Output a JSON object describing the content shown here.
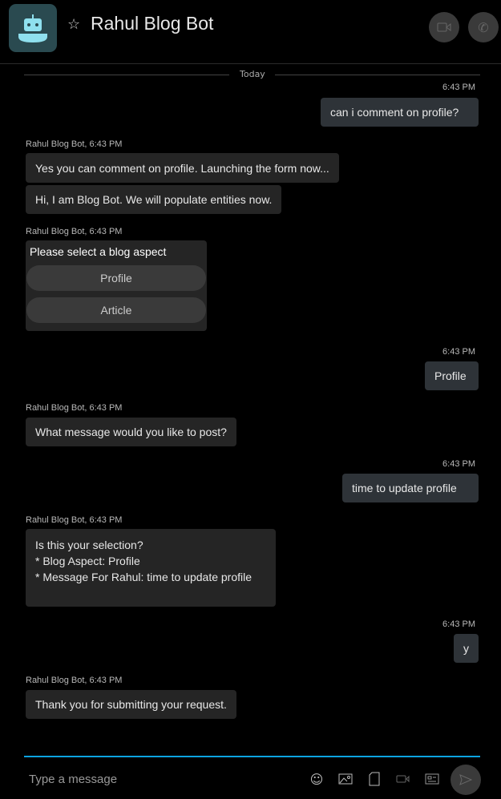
{
  "header": {
    "title": "Rahul Blog Bot",
    "video_icon": "video-call-icon",
    "call_icon": "phone-icon"
  },
  "divider": {
    "label": "Today"
  },
  "messages": [
    {
      "from": "user",
      "time": "6:43 PM",
      "text": "can i comment on profile?"
    },
    {
      "from": "bot",
      "label": "Rahul Blog Bot, 6:43 PM",
      "texts": [
        "Yes you can comment on profile. Launching the form now...",
        "Hi, I am Blog Bot. We will populate entities now."
      ]
    },
    {
      "from": "bot",
      "label": "Rahul Blog Bot, 6:43 PM",
      "card": {
        "title": "Please select a blog aspect",
        "options": [
          "Profile",
          "Article"
        ]
      }
    },
    {
      "from": "user",
      "time": "6:43 PM",
      "text": "Profile"
    },
    {
      "from": "bot",
      "label": "Rahul Blog Bot, 6:43 PM",
      "text": "What message would you like to post?"
    },
    {
      "from": "user",
      "time": "6:43 PM",
      "text": "time to update profile"
    },
    {
      "from": "bot",
      "label": "Rahul Blog Bot, 6:43 PM",
      "text": "Is this your selection?\n* Blog Aspect: Profile\n* Message For Rahul: time to update profile"
    },
    {
      "from": "user",
      "time": "6:43 PM",
      "text": "y"
    },
    {
      "from": "bot",
      "label": "Rahul Blog Bot, 6:43 PM",
      "text": "Thank you for submitting your request."
    }
  ],
  "composer": {
    "placeholder": "Type a message",
    "accent": "#0ca3e0"
  }
}
